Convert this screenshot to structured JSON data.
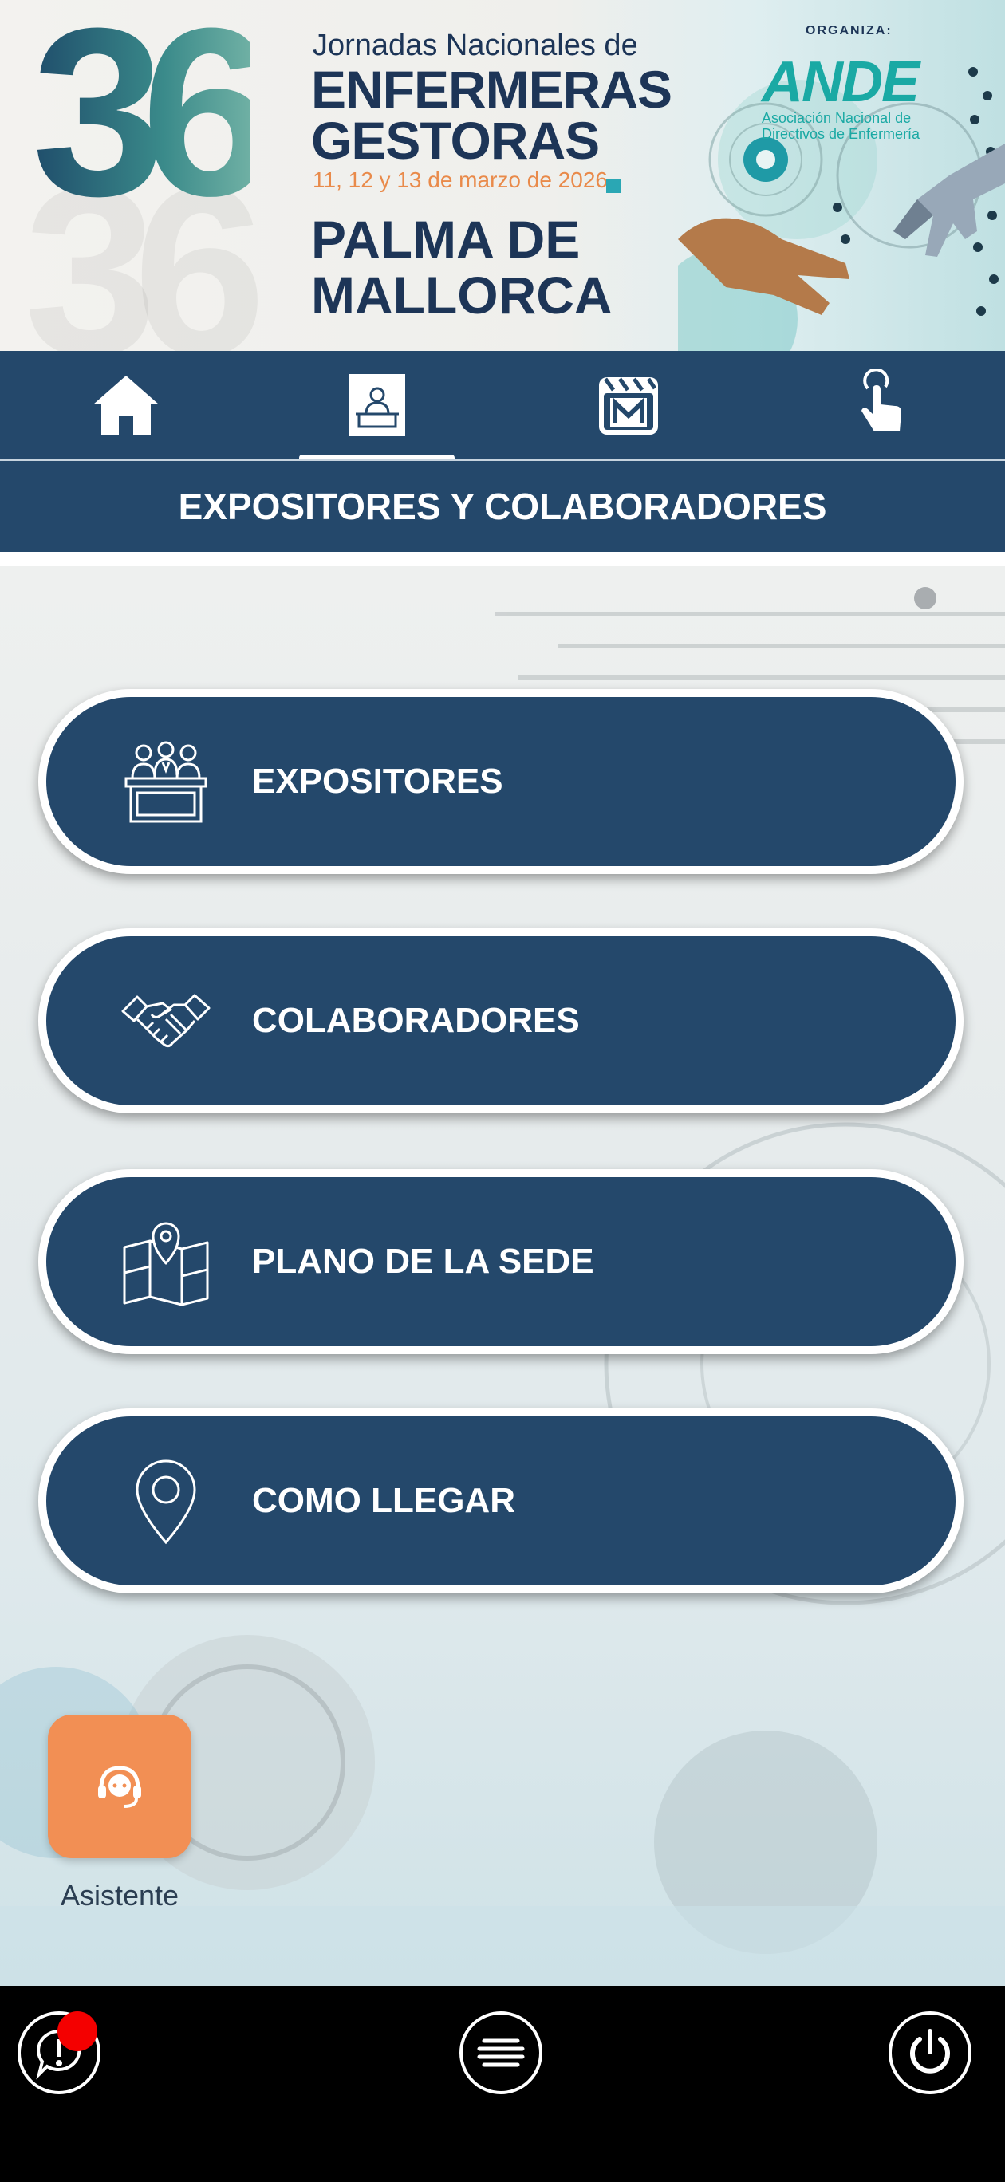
{
  "banner": {
    "number": "36",
    "subtitle": "Jornadas Nacionales de",
    "title_line1": "ENFERMERAS",
    "title_line2": "GESTORAS",
    "dates": "11, 12 y 13 de marzo de 2026",
    "city_line1": "PALMA DE",
    "city_line2": "MALLORCA",
    "organizer_label": "ORGANIZA:",
    "organizer_logo": "ANDE",
    "organizer_name": "Asociación Nacional de Directivos de Enfermería"
  },
  "tabs": [
    {
      "icon": "home-icon",
      "active": false
    },
    {
      "icon": "reception-desk-icon",
      "active": true
    },
    {
      "icon": "film-clapper-m-icon",
      "active": false
    },
    {
      "icon": "touch-hand-icon",
      "active": false
    }
  ],
  "section_title": "EXPOSITORES Y COLABORADORES",
  "menu": [
    {
      "label": "EXPOSITORES",
      "icon": "exhibitors-booth-icon"
    },
    {
      "label": "COLABORADORES",
      "icon": "handshake-icon"
    },
    {
      "label": "PLANO DE LA SEDE",
      "icon": "map-pin-icon"
    },
    {
      "label": "COMO LLEGAR",
      "icon": "location-pin-icon"
    }
  ],
  "assistant": {
    "label": "Asistente",
    "icon": "headset-agent-icon",
    "color": "#f28f54"
  },
  "bottom_bar": {
    "left_icon": "speech-alert-icon",
    "center_icon": "menu-lines-icon",
    "right_icon": "power-icon",
    "badge_color": "#f40000"
  },
  "colors": {
    "primary": "#24486b",
    "accent": "#f28f54"
  }
}
